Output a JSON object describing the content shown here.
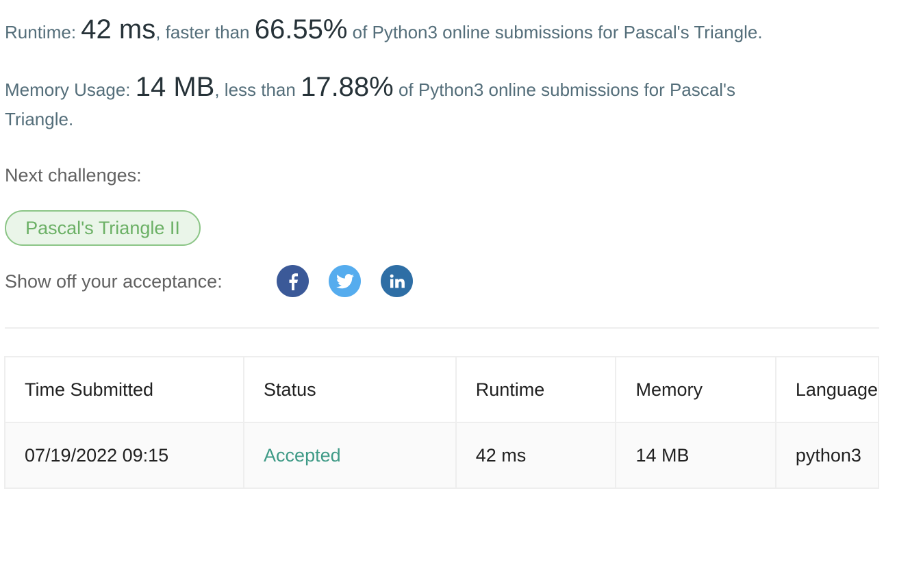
{
  "summary": {
    "runtime_label": "Runtime: ",
    "runtime_value": "42 ms",
    "runtime_mid": ", faster than ",
    "runtime_percent": "66.55%",
    "runtime_tail": " of Python3 online submissions for Pascal's Triangle.",
    "memory_label": "Memory Usage: ",
    "memory_value": "14 MB",
    "memory_mid": ", less than ",
    "memory_percent": "17.88%",
    "memory_tail": " of Python3 online submissions for Pascal's",
    "memory_tail2": "Triangle."
  },
  "next": {
    "label": "Next challenges:",
    "items": [
      "Pascal's Triangle II"
    ]
  },
  "share": {
    "label": "Show off your acceptance:",
    "icons": [
      "facebook-icon",
      "twitter-icon",
      "linkedin-icon"
    ],
    "colors": {
      "facebook": "#3b5998",
      "twitter": "#55acee",
      "linkedin": "#2e6ea5"
    }
  },
  "table": {
    "headers": [
      "Time Submitted",
      "Status",
      "Runtime",
      "Memory",
      "Language"
    ],
    "rows": [
      [
        "07/19/2022 09:15",
        "Accepted",
        "42 ms",
        "14 MB",
        "python3"
      ]
    ]
  },
  "colors": {
    "accepted": "#3e9a86",
    "tag_text": "#6bb065",
    "tag_border": "#8bc586",
    "tag_bg": "#eaf5e9"
  }
}
